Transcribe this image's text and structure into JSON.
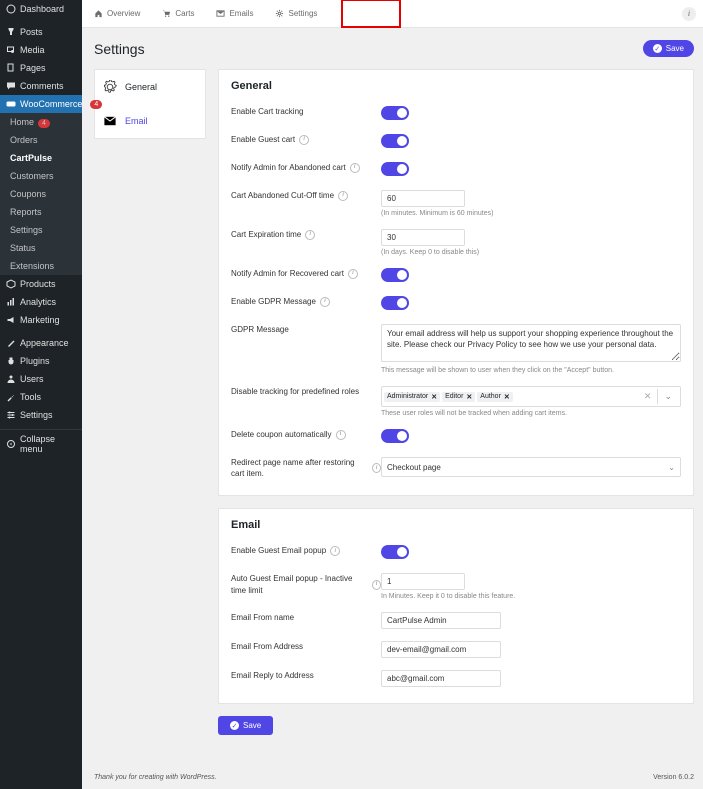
{
  "wp_sidebar": {
    "dashboard": "Dashboard",
    "posts": "Posts",
    "media": "Media",
    "pages": "Pages",
    "comments": "Comments",
    "woocommerce": "WooCommerce",
    "woo_badge": "4",
    "sub": {
      "home": "Home",
      "home_badge": "4",
      "orders": "Orders",
      "cartpulse": "CartPulse",
      "customers": "Customers",
      "coupons": "Coupons",
      "reports": "Reports",
      "settings": "Settings",
      "status": "Status",
      "extensions": "Extensions"
    },
    "products": "Products",
    "analytics": "Analytics",
    "marketing": "Marketing",
    "appearance": "Appearance",
    "plugins": "Plugins",
    "users": "Users",
    "tools": "Tools",
    "settings": "Settings",
    "collapse": "Collapse menu"
  },
  "topbar": {
    "overview": "Overview",
    "carts": "Carts",
    "emails": "Emails",
    "settings": "Settings",
    "info": "i"
  },
  "page_title": "Settings",
  "save_label": "Save",
  "subnav": {
    "general": "General",
    "email": "Email"
  },
  "general": {
    "heading": "General",
    "enable_tracking": "Enable Cart tracking",
    "enable_guest": "Enable Guest cart",
    "notify_abandoned": "Notify Admin for Abandoned cart",
    "cutoff_label": "Cart Abandoned Cut-Off time",
    "cutoff_value": "60",
    "cutoff_help": "(In minutes. Minimum is 60 minutes)",
    "expire_label": "Cart Expiration time",
    "expire_value": "30",
    "expire_help": "(In days. Keep 0 to disable this)",
    "notify_recovered": "Notify Admin for Recovered cart",
    "enable_gdpr": "Enable GDPR Message",
    "gdpr_msg_label": "GDPR Message",
    "gdpr_msg_value": "Your email address will help us support your shopping experience throughout the site. Please check our Privacy Policy to see how we use your personal data.",
    "gdpr_help": "This message will be shown to user when they click on the \"Accept\" button.",
    "roles_label": "Disable tracking for predefined roles",
    "roles": [
      "Administrator",
      "Editor",
      "Author"
    ],
    "roles_help": "These user roles will not be tracked when adding cart items.",
    "delete_coupon": "Delete coupon automatically",
    "redirect_label": "Redirect page name after restoring cart item.",
    "redirect_value": "Checkout page"
  },
  "email": {
    "heading": "Email",
    "popup_label": "Enable Guest Email popup",
    "inactive_label": "Auto Guest Email popup - Inactive time limit",
    "inactive_value": "1",
    "inactive_help": "In Minutes. Keep it 0 to disable this feature.",
    "from_name_label": "Email From name",
    "from_name_value": "CartPulse Admin",
    "from_addr_label": "Email From Address",
    "from_addr_value": "dev-email@gmail.com",
    "reply_to_label": "Email Reply to Address",
    "reply_to_value": "abc@gmail.com"
  },
  "footer": {
    "thank": "Thank you for creating with WordPress.",
    "version": "Version 6.0.2"
  }
}
